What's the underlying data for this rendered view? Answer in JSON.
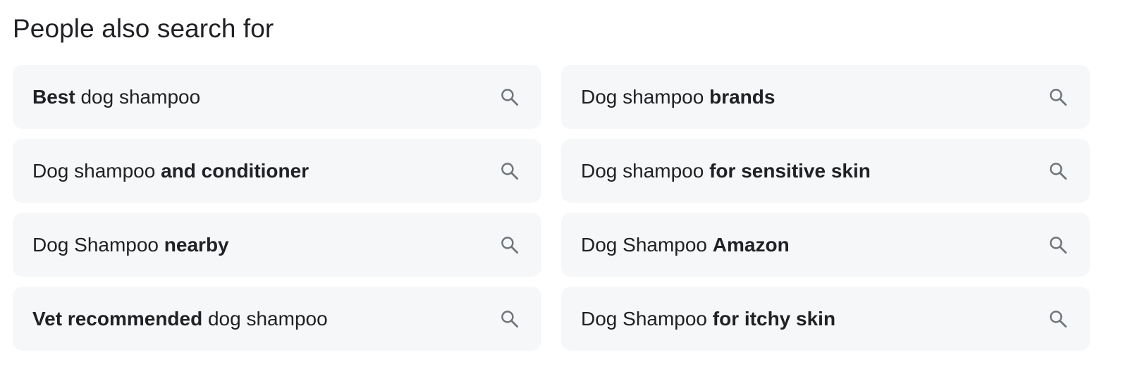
{
  "section": {
    "title": "People also search for"
  },
  "suggestions": [
    {
      "parts": [
        {
          "text": "Best",
          "bold": true
        },
        {
          "text": " dog shampoo",
          "bold": false
        }
      ],
      "icon": "search-icon"
    },
    {
      "parts": [
        {
          "text": "Dog shampoo ",
          "bold": false
        },
        {
          "text": "brands",
          "bold": true
        }
      ],
      "icon": "search-icon"
    },
    {
      "parts": [
        {
          "text": "Dog shampoo ",
          "bold": false
        },
        {
          "text": "and conditioner",
          "bold": true
        }
      ],
      "icon": "search-icon"
    },
    {
      "parts": [
        {
          "text": "Dog shampoo ",
          "bold": false
        },
        {
          "text": "for sensitive skin",
          "bold": true
        }
      ],
      "icon": "search-icon"
    },
    {
      "parts": [
        {
          "text": "Dog Shampoo ",
          "bold": false
        },
        {
          "text": "nearby",
          "bold": true
        }
      ],
      "icon": "search-icon"
    },
    {
      "parts": [
        {
          "text": "Dog Shampoo ",
          "bold": false
        },
        {
          "text": "Amazon",
          "bold": true
        }
      ],
      "icon": "search-icon"
    },
    {
      "parts": [
        {
          "text": "Vet recommended",
          "bold": true
        },
        {
          "text": " dog shampoo",
          "bold": false
        }
      ],
      "icon": "search-icon"
    },
    {
      "parts": [
        {
          "text": "Dog Shampoo ",
          "bold": false
        },
        {
          "text": "for itchy skin",
          "bold": true
        }
      ],
      "icon": "search-icon"
    }
  ],
  "colors": {
    "chip_background": "#f6f7f9",
    "text": "#202124",
    "icon": "#70757a"
  }
}
